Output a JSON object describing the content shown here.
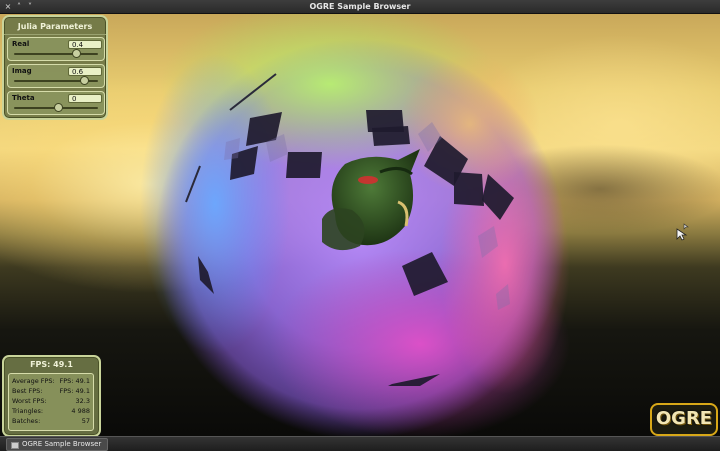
{
  "window": {
    "title": "OGRE Sample Browser",
    "close_glyph": "×",
    "minimize_glyph": "˄",
    "maximize_glyph": "˅"
  },
  "julia_panel": {
    "title": "Julia Parameters",
    "sliders": [
      {
        "label": "Real",
        "value": "0.4",
        "level": 0.7
      },
      {
        "label": "Imag",
        "value": "0.6",
        "level": 0.8
      },
      {
        "label": "Theta",
        "value": "0",
        "level": 0.5
      }
    ]
  },
  "stats_panel": {
    "fps_label": "FPS:  49.1",
    "rows": [
      {
        "key": "Average FPS:",
        "value": "FPS: 49.1"
      },
      {
        "key": "Best FPS:",
        "value": "FPS: 49.1"
      },
      {
        "key": "Worst FPS:",
        "value": "32.3"
      },
      {
        "key": "Triangles:",
        "value": "4 988"
      },
      {
        "key": "Batches:",
        "value": "57"
      }
    ]
  },
  "logo": {
    "text": "OGRE"
  },
  "taskbar": {
    "task_label": "OGRE Sample Browser"
  },
  "icons": [
    "window-close-icon",
    "window-minimize-icon",
    "window-maximize-icon",
    "app-window-icon",
    "mouse-cursor-icon"
  ],
  "colors": {
    "panel": "#6e7646",
    "panel_border": "#c9d49a",
    "logo_border": "#d8a818"
  }
}
